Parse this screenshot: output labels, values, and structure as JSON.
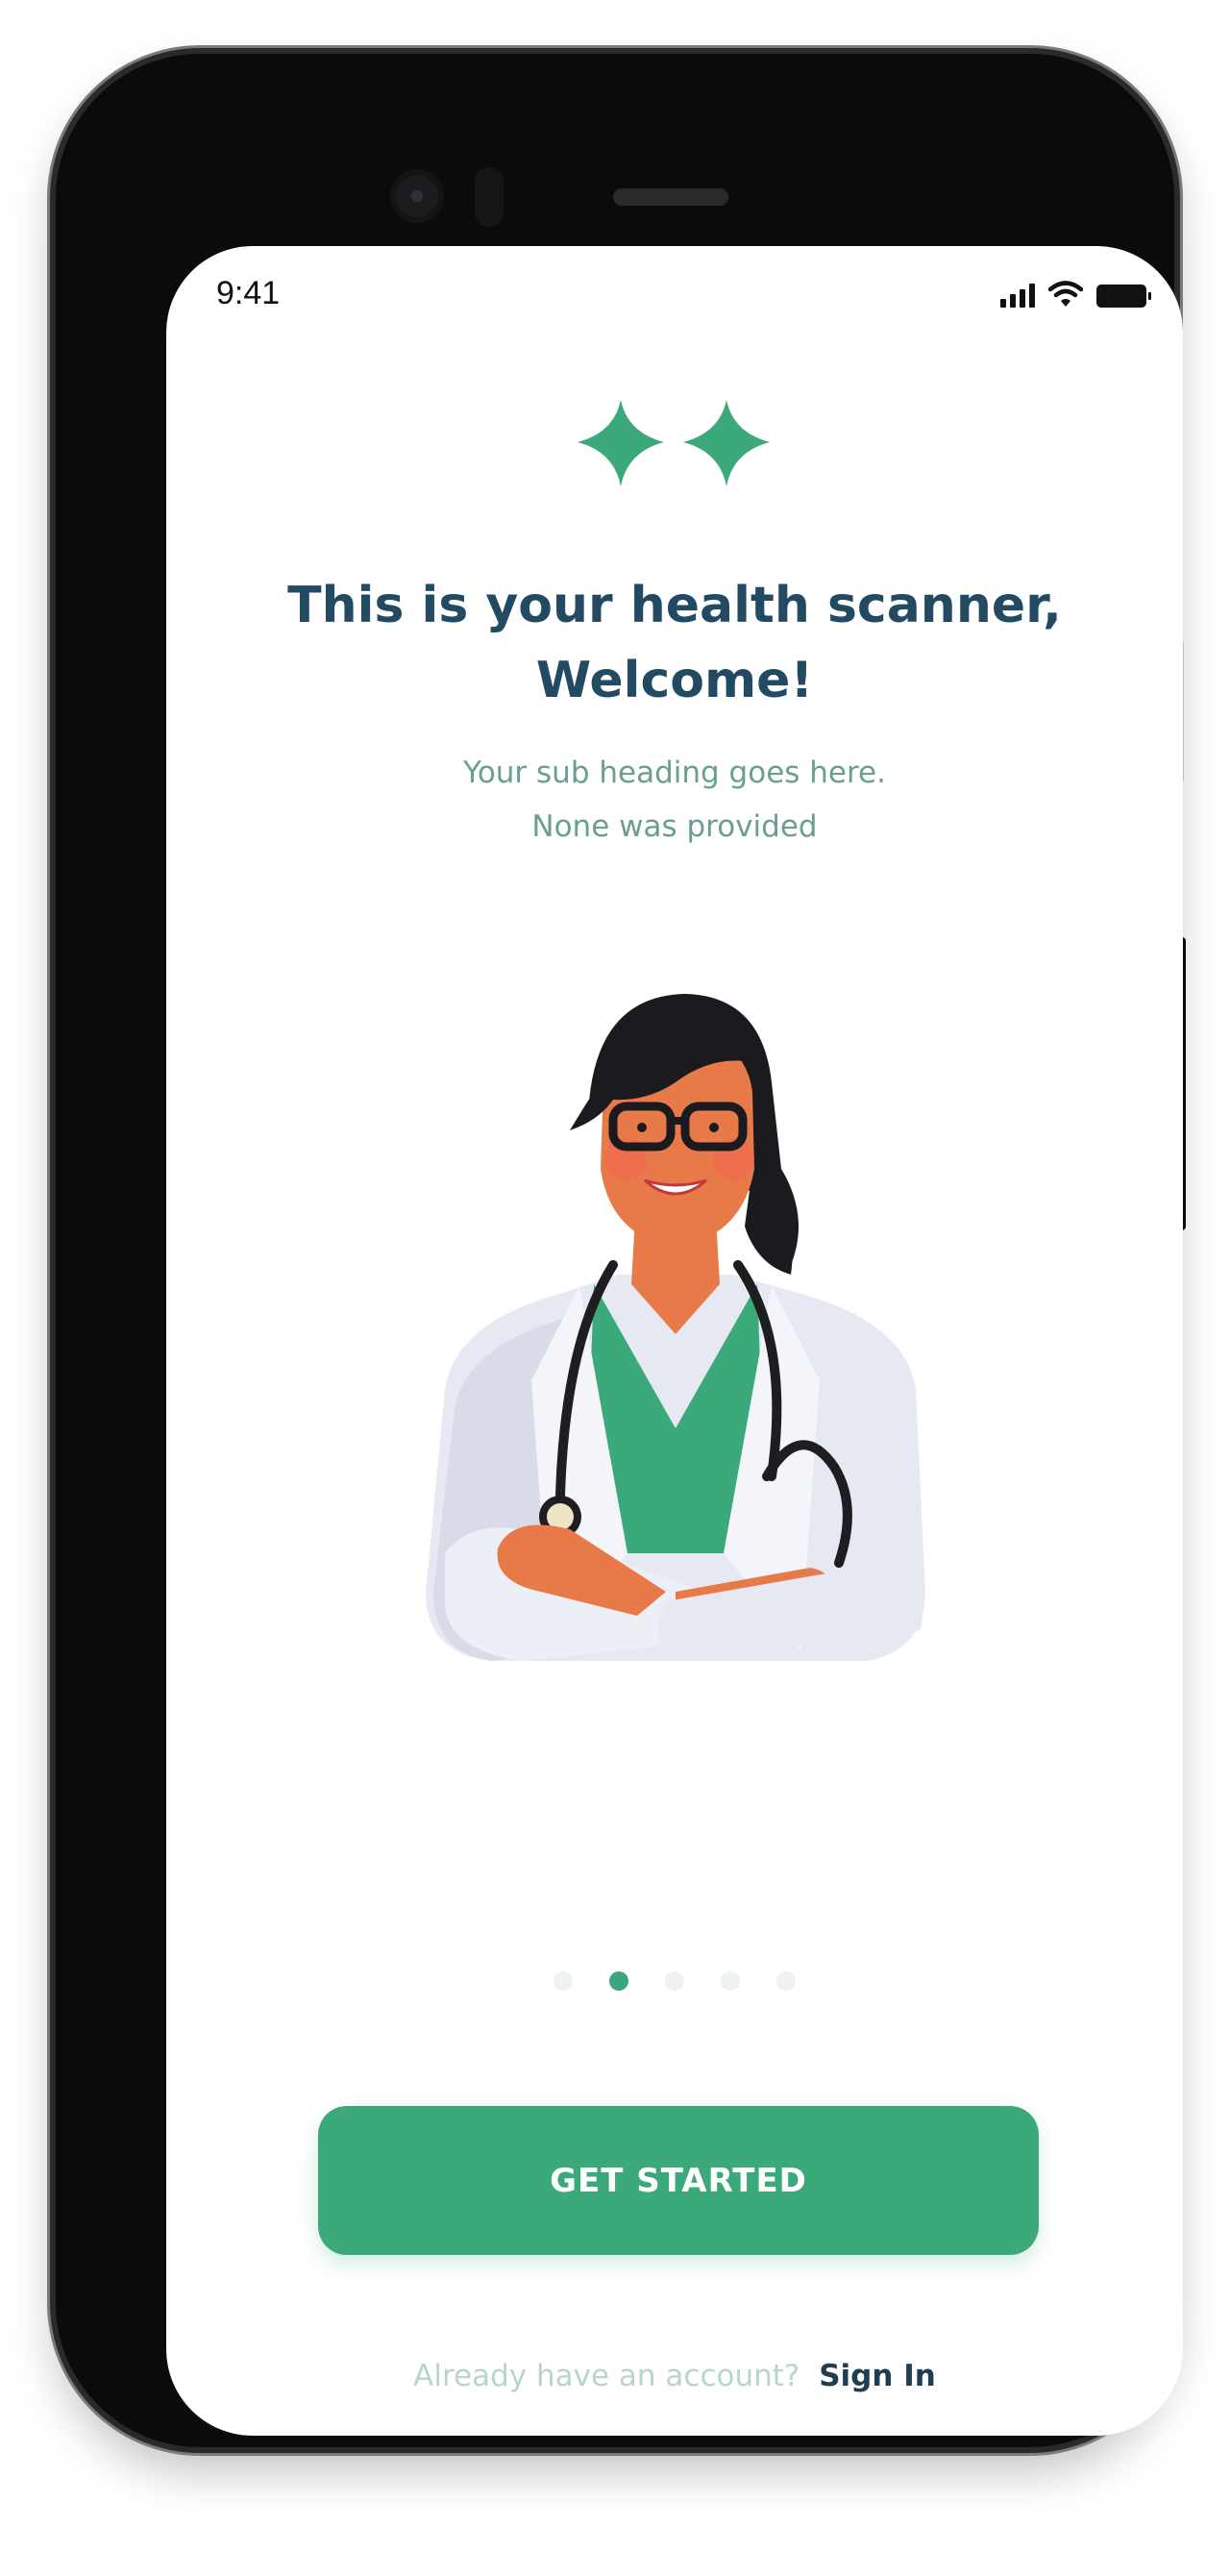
{
  "status_bar": {
    "time": "9:41",
    "icons": [
      "cellular-signal-icon",
      "wifi-icon",
      "battery-icon"
    ]
  },
  "logo": {
    "icon": "double-plus-icon",
    "color": "#3ba97a"
  },
  "header": {
    "title_line1": "This is your health scanner,",
    "title_line2": "Welcome!",
    "subtitle_line1": "Your sub heading goes here.",
    "subtitle_line2": "None was provided"
  },
  "illustration": {
    "icon": "doctor-illustration"
  },
  "pagination": {
    "count": 5,
    "active_index": 1
  },
  "cta": {
    "label": "GET STARTED"
  },
  "footer": {
    "prompt": "Already have an account?",
    "link": "Sign In"
  },
  "colors": {
    "accent": "#3ba97a",
    "title": "#234a63",
    "subtitle": "#6aa08b",
    "prompt": "#b7d6c9",
    "link": "#1f3e52"
  }
}
